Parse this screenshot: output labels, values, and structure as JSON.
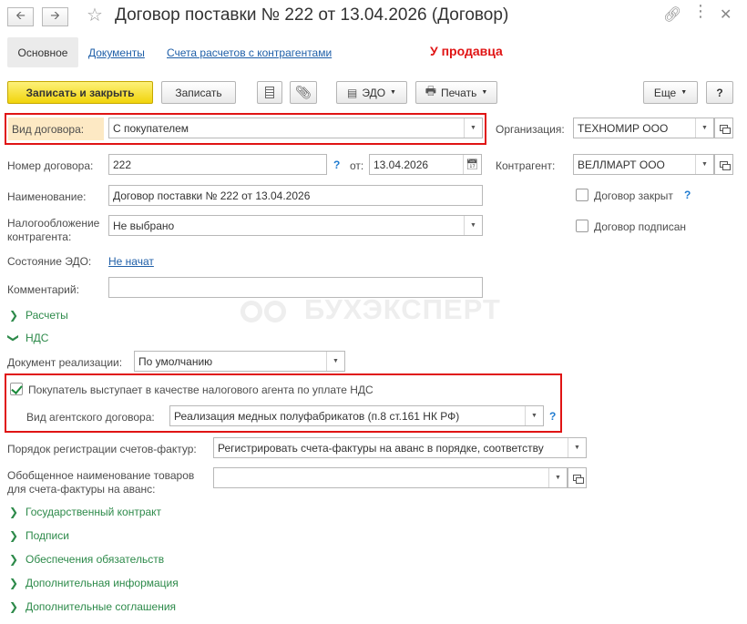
{
  "window": {
    "title": "Договор поставки № 222 от 13.04.2026 (Договор)"
  },
  "tabs": [
    {
      "label": "Основное"
    },
    {
      "label": "Документы"
    },
    {
      "label": "Счета расчетов с контрагентами"
    }
  ],
  "side_note": "У продавца",
  "toolbar": {
    "save_close": "Записать и закрыть",
    "save": "Записать",
    "edo": "ЭДО",
    "print": "Печать",
    "more": "Еще",
    "help": "?"
  },
  "form": {
    "contract_type_label": "Вид договора:",
    "contract_type_value": "С покупателем",
    "organization_label": "Организация:",
    "organization_value": "ТЕХНОМИР ООО",
    "number_label": "Номер договора:",
    "number_value": "222",
    "date_label": "от:",
    "date_value": "13.04.2026",
    "counterparty_label": "Контрагент:",
    "counterparty_value": "ВЕЛЛМАРТ ООО",
    "name_label": "Наименование:",
    "name_value": "Договор поставки № 222 от 13.04.2026",
    "closed_label": "Договор закрыт",
    "closed_checked": false,
    "tax_label_line1": "Налогообложение",
    "tax_label_line2": "контрагента:",
    "tax_value": "Не выбрано",
    "signed_label": "Договор подписан",
    "signed_checked": false,
    "edo_state_label": "Состояние ЭДО:",
    "edo_state_value": "Не начат",
    "comment_label": "Комментарий:",
    "comment_value": "",
    "sale_doc_label": "Документ реализации:",
    "sale_doc_value": "По умолчанию",
    "tax_agent_label": "Покупатель выступает в качестве налогового агента по уплате НДС",
    "tax_agent_checked": true,
    "agent_contract_label": "Вид агентского договора:",
    "agent_contract_value": "Реализация медных полуфабрикатов (п.8 ст.161 НК РФ)",
    "invoice_order_label": "Порядок регистрации счетов-фактур:",
    "invoice_order_value": "Регистрировать счета-фактуры на аванс в порядке, соответству",
    "goods_name_label_line1": "Обобщенное наименование товаров",
    "goods_name_label_line2": "для счета-фактуры на аванс:",
    "goods_name_value": ""
  },
  "sections": {
    "settlements": "Расчеты",
    "vat": "НДС",
    "gov_contract": "Государственный контракт",
    "signatures": "Подписи",
    "obligations": "Обеспечения обязательств",
    "extra_info": "Дополнительная информация",
    "extra_agreements": "Дополнительные соглашения"
  },
  "watermark": "БУХЭКСПЕРТ",
  "colors": {
    "accent_yellow": "#f5d61a",
    "highlight_red": "#e01414",
    "section_green": "#2d8a4a",
    "link_blue": "#1f5fa8",
    "label_highlight": "#fde9c4"
  }
}
